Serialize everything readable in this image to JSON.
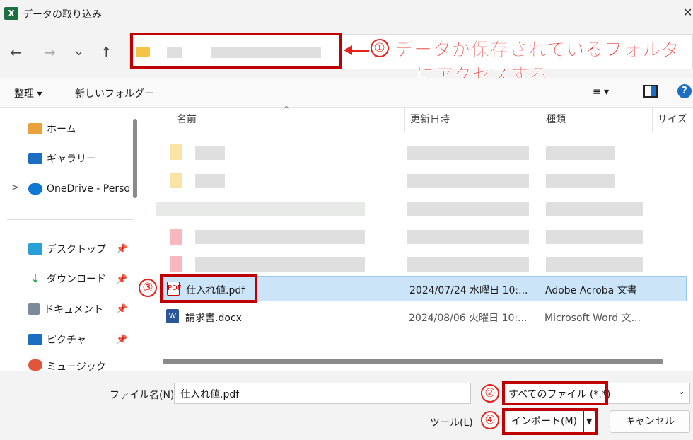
{
  "window": {
    "title": "データの取り込み",
    "app_icon": "excel-icon",
    "close": "✕"
  },
  "nav": {
    "back": "←",
    "forward": "→",
    "recent": "⌄",
    "up": "↑"
  },
  "toolbar": {
    "organize": "整理 ▾",
    "new_folder": "新しいフォルダー",
    "view_menu": "≡ ▾",
    "help": "?"
  },
  "sidebar": {
    "items": [
      {
        "label": "ホーム"
      },
      {
        "label": "ギャラリー"
      },
      {
        "label": "OneDrive - Perso",
        "expand": ">"
      },
      {
        "label": "デスクトップ",
        "pin": "📌"
      },
      {
        "label": "ダウンロード",
        "pin": "📌"
      },
      {
        "label": "ドキュメント",
        "pin": "📌"
      },
      {
        "label": "ピクチャ",
        "pin": "📌"
      },
      {
        "label": "ミュージック",
        "pin": "📌"
      }
    ]
  },
  "columns": {
    "name": "名前",
    "modified": "更新日時",
    "type": "種類",
    "size": "サイズ"
  },
  "files": [
    {
      "name": "仕入れ値.pdf",
      "modified": "2024/07/24 水曜日 10:...",
      "type": "Adobe Acroba 文書",
      "selected": true
    },
    {
      "name": "請求書.docx",
      "modified": "2024/08/06 火曜日 10:...",
      "type": "Microsoft Word 文...",
      "selected": false
    }
  ],
  "bottom": {
    "filename_label": "ファイル名(N):",
    "filename_value": "仕入れ値.pdf",
    "filetype_value": "すべてのファイル (*.*)",
    "tools": "ツール(L)",
    "import": "インポート(M)",
    "cancel": "キャンセル"
  },
  "annotations": {
    "step1_num": "①",
    "step1_line1": "データが保存されているフォルダ",
    "step1_line2": "にアクセスする",
    "step2_num": "②",
    "step3_num": "③",
    "step4_num": "④",
    "accent_color": "#e8201a"
  }
}
